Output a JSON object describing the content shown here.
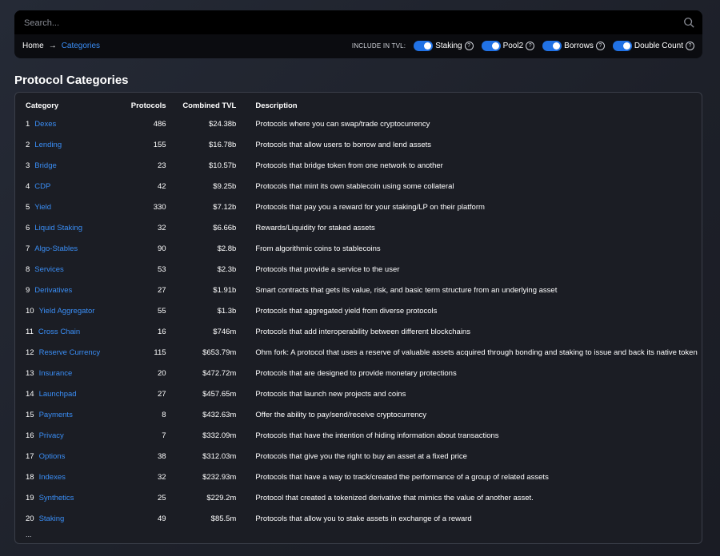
{
  "search": {
    "placeholder": "Search..."
  },
  "breadcrumb": {
    "home": "Home",
    "current": "Categories"
  },
  "toggles": {
    "label": "INCLUDE IN TVL:",
    "items": [
      {
        "label": "Staking",
        "on": true
      },
      {
        "label": "Pool2",
        "on": true
      },
      {
        "label": "Borrows",
        "on": true
      },
      {
        "label": "Double Count",
        "on": true
      }
    ]
  },
  "page": {
    "title": "Protocol Categories"
  },
  "table": {
    "headers": {
      "category": "Category",
      "protocols": "Protocols",
      "tvl": "Combined TVL",
      "description": "Description"
    },
    "rows": [
      {
        "rank": "1",
        "name": "Dexes",
        "protocols": "486",
        "tvl": "$24.38b",
        "description": "Protocols where you can swap/trade cryptocurrency"
      },
      {
        "rank": "2",
        "name": "Lending",
        "protocols": "155",
        "tvl": "$16.78b",
        "description": "Protocols that allow users to borrow and lend assets"
      },
      {
        "rank": "3",
        "name": "Bridge",
        "protocols": "23",
        "tvl": "$10.57b",
        "description": "Protocols that bridge token from one network to another"
      },
      {
        "rank": "4",
        "name": "CDP",
        "protocols": "42",
        "tvl": "$9.25b",
        "description": "Protocols that mint its own stablecoin using some collateral"
      },
      {
        "rank": "5",
        "name": "Yield",
        "protocols": "330",
        "tvl": "$7.12b",
        "description": "Protocols that pay you a reward for your staking/LP on their platform"
      },
      {
        "rank": "6",
        "name": "Liquid Staking",
        "protocols": "32",
        "tvl": "$6.66b",
        "description": "Rewards/Liquidity for staked assets"
      },
      {
        "rank": "7",
        "name": "Algo-Stables",
        "protocols": "90",
        "tvl": "$2.8b",
        "description": "From algorithmic coins to stablecoins"
      },
      {
        "rank": "8",
        "name": "Services",
        "protocols": "53",
        "tvl": "$2.3b",
        "description": "Protocols that provide a service to the user"
      },
      {
        "rank": "9",
        "name": "Derivatives",
        "protocols": "27",
        "tvl": "$1.91b",
        "description": "Smart contracts that gets its value, risk, and basic term structure from an underlying asset"
      },
      {
        "rank": "10",
        "name": "Yield Aggregator",
        "protocols": "55",
        "tvl": "$1.3b",
        "description": "Protocols that aggregated yield from diverse protocols"
      },
      {
        "rank": "11",
        "name": "Cross Chain",
        "protocols": "16",
        "tvl": "$746m",
        "description": "Protocols that add interoperability between different blockchains"
      },
      {
        "rank": "12",
        "name": "Reserve Currency",
        "protocols": "115",
        "tvl": "$653.79m",
        "description": "Ohm fork: A protocol that uses a reserve of valuable assets acquired through bonding and staking to issue and back its native token"
      },
      {
        "rank": "13",
        "name": "Insurance",
        "protocols": "20",
        "tvl": "$472.72m",
        "description": "Protocols that are designed to provide monetary protections"
      },
      {
        "rank": "14",
        "name": "Launchpad",
        "protocols": "27",
        "tvl": "$457.65m",
        "description": "Protocols that launch new projects and coins"
      },
      {
        "rank": "15",
        "name": "Payments",
        "protocols": "8",
        "tvl": "$432.63m",
        "description": "Offer the ability to pay/send/receive cryptocurrency"
      },
      {
        "rank": "16",
        "name": "Privacy",
        "protocols": "7",
        "tvl": "$332.09m",
        "description": "Protocols that have the intention of hiding information about transactions"
      },
      {
        "rank": "17",
        "name": "Options",
        "protocols": "38",
        "tvl": "$312.03m",
        "description": "Protocols that give you the right to buy an asset at a fixed price"
      },
      {
        "rank": "18",
        "name": "Indexes",
        "protocols": "32",
        "tvl": "$232.93m",
        "description": "Protocols that have a way to track/created the performance of a group of related assets"
      },
      {
        "rank": "19",
        "name": "Synthetics",
        "protocols": "25",
        "tvl": "$229.2m",
        "description": "Protocol that created a tokenized derivative that mimics the value of another asset."
      },
      {
        "rank": "20",
        "name": "Staking",
        "protocols": "49",
        "tvl": "$85.5m",
        "description": "Protocols that allow you to stake assets in exchange of a reward"
      }
    ],
    "more": "..."
  },
  "colors": {
    "accent": "#2172e5",
    "link": "#3a8ef6",
    "background": "#1d2029"
  }
}
